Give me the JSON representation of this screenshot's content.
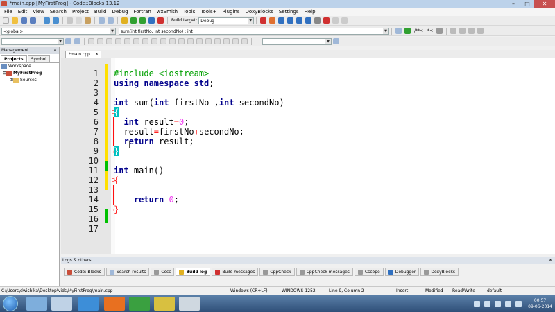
{
  "window": {
    "title": "*main.cpp [MyFirstProg] - Code::Blocks 13.12"
  },
  "menu": [
    "File",
    "Edit",
    "View",
    "Search",
    "Project",
    "Build",
    "Debug",
    "Fortran",
    "wxSmith",
    "Tools",
    "Tools+",
    "Plugins",
    "DoxyBlocks",
    "Settings",
    "Help"
  ],
  "toolbar": {
    "build_target": "Debug",
    "scope": "<global>",
    "function": "sum(int firstNo, int secondNo) : int",
    "comment_buttons": [
      "/**<",
      "*<"
    ]
  },
  "management": {
    "title": "Management",
    "tabs": [
      "Projects",
      "Symbol"
    ],
    "tree": [
      {
        "label": "Workspace",
        "level": 0
      },
      {
        "label": "MyFirstProg",
        "level": 1
      },
      {
        "label": "Sources",
        "level": 2
      }
    ]
  },
  "editor": {
    "tab": "*main.cpp",
    "line_numbers": [
      "1",
      "2",
      "3",
      "4",
      "5",
      "6",
      "7",
      "8",
      "9",
      "10",
      "11",
      "12",
      "13",
      "14",
      "15",
      "16",
      "17"
    ]
  },
  "logs": {
    "title": "Logs & others",
    "tabs": [
      "Code::Blocks",
      "Search results",
      "Cccc",
      "Build log",
      "Build messages",
      "CppCheck",
      "CppCheck messages",
      "Cscope",
      "Debugger",
      "DoxyBlocks"
    ],
    "active_tab": "Build log"
  },
  "status": {
    "path": "C:\\Users\\dwishika\\Desktop\\vids\\MyFirstProg\\main.cpp",
    "eol": "Windows (CR+LF)",
    "encoding": "WINDOWS-1252",
    "position": "Line 9, Column 2",
    "mode": "Insert",
    "modified": "Modified",
    "access": "Read/Write",
    "lang": "default"
  },
  "taskbar": {
    "time": "00:57",
    "date": "09-06-2014"
  },
  "colors": {
    "keyword": "#00008b",
    "preprocessor": "#00a000",
    "number": "#f040f0",
    "operator": "#ff2020",
    "brace_match": "#00c0c0"
  }
}
